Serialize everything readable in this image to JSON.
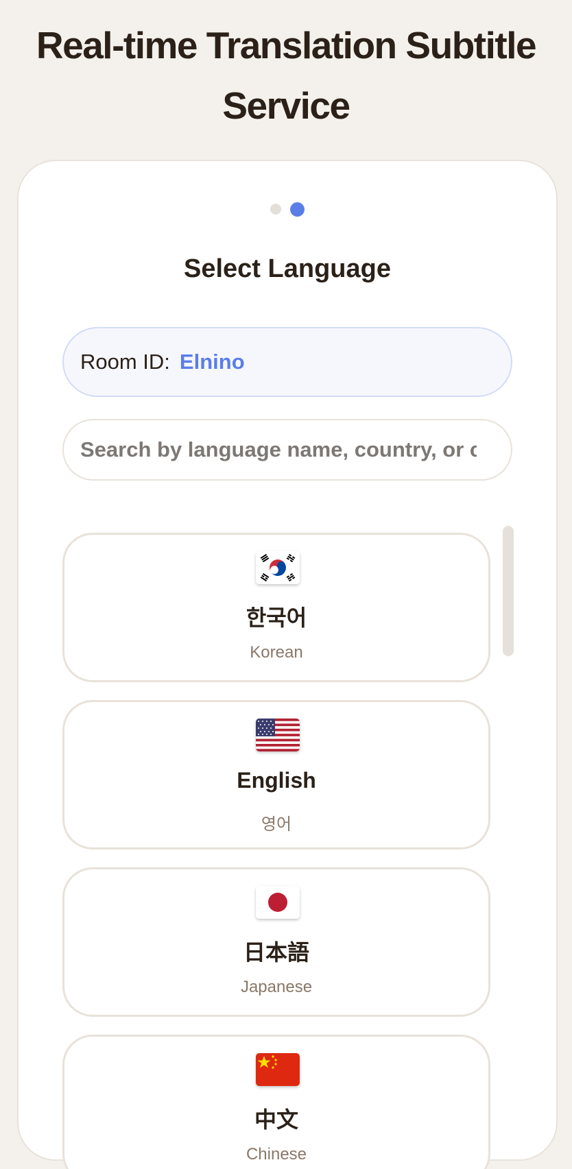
{
  "header": {
    "title": "Real-time Translation Subtitle Service"
  },
  "steps": {
    "total": 2,
    "current": 2
  },
  "section": {
    "title": "Select Language"
  },
  "room": {
    "label": "Room ID:",
    "value": "Elnino"
  },
  "search": {
    "placeholder": "Search by language name, country, or code",
    "value": ""
  },
  "languages": [
    {
      "name": "한국어",
      "subtitle": "Korean",
      "flag_icon": "south-korea-flag-icon"
    },
    {
      "name": "English",
      "subtitle": "영어",
      "flag_icon": "usa-flag-icon"
    },
    {
      "name": "日本語",
      "subtitle": "Japanese",
      "flag_icon": "japan-flag-icon"
    },
    {
      "name": "中文",
      "subtitle": "Chinese",
      "flag_icon": "china-flag-icon"
    }
  ],
  "colors": {
    "accent": "#5a7ee8",
    "background": "#f4f1ec",
    "card": "#ffffff",
    "border": "#e8e2da",
    "text": "#2b2118",
    "muted": "#8a7768"
  }
}
